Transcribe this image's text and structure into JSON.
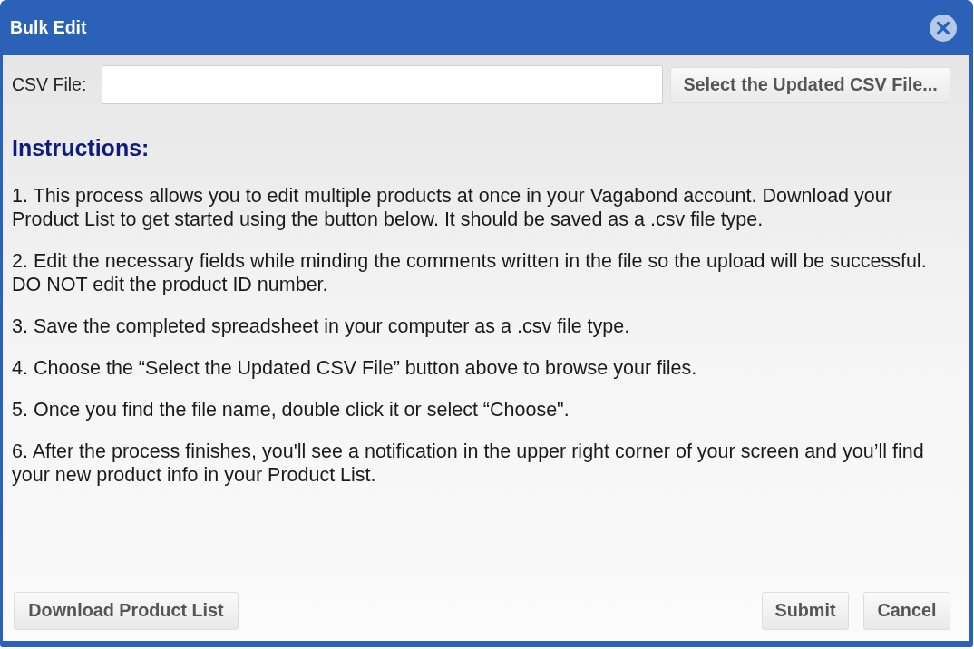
{
  "window": {
    "title": "Bulk Edit"
  },
  "csv_file": {
    "label": "CSV File:",
    "button": "Select the Updated CSV File..."
  },
  "instructions": {
    "heading": "Instructions:",
    "steps": [
      "1. This process allows you to edit multiple products at once in your Vagabond account. Download your Product List to get started using the button below. It should be saved as a .csv file type.",
      "2. Edit the necessary fields while minding the comments written in the file so the upload will be successful. DO NOT edit the product ID number.",
      "3. Save the completed spreadsheet in your computer as a .csv file type.",
      "4. Choose the “Select the Updated CSV File” button above to browse your files.",
      "5. Once you find the file name, double click it or select “Choose\".",
      "6. After the process finishes, you'll see a notification in the upper right corner of your screen and you’ll find your new product info in your Product List."
    ]
  },
  "footer": {
    "left_buttons": [
      "Download Product List"
    ],
    "right_buttons": [
      "Submit",
      "Cancel"
    ]
  }
}
